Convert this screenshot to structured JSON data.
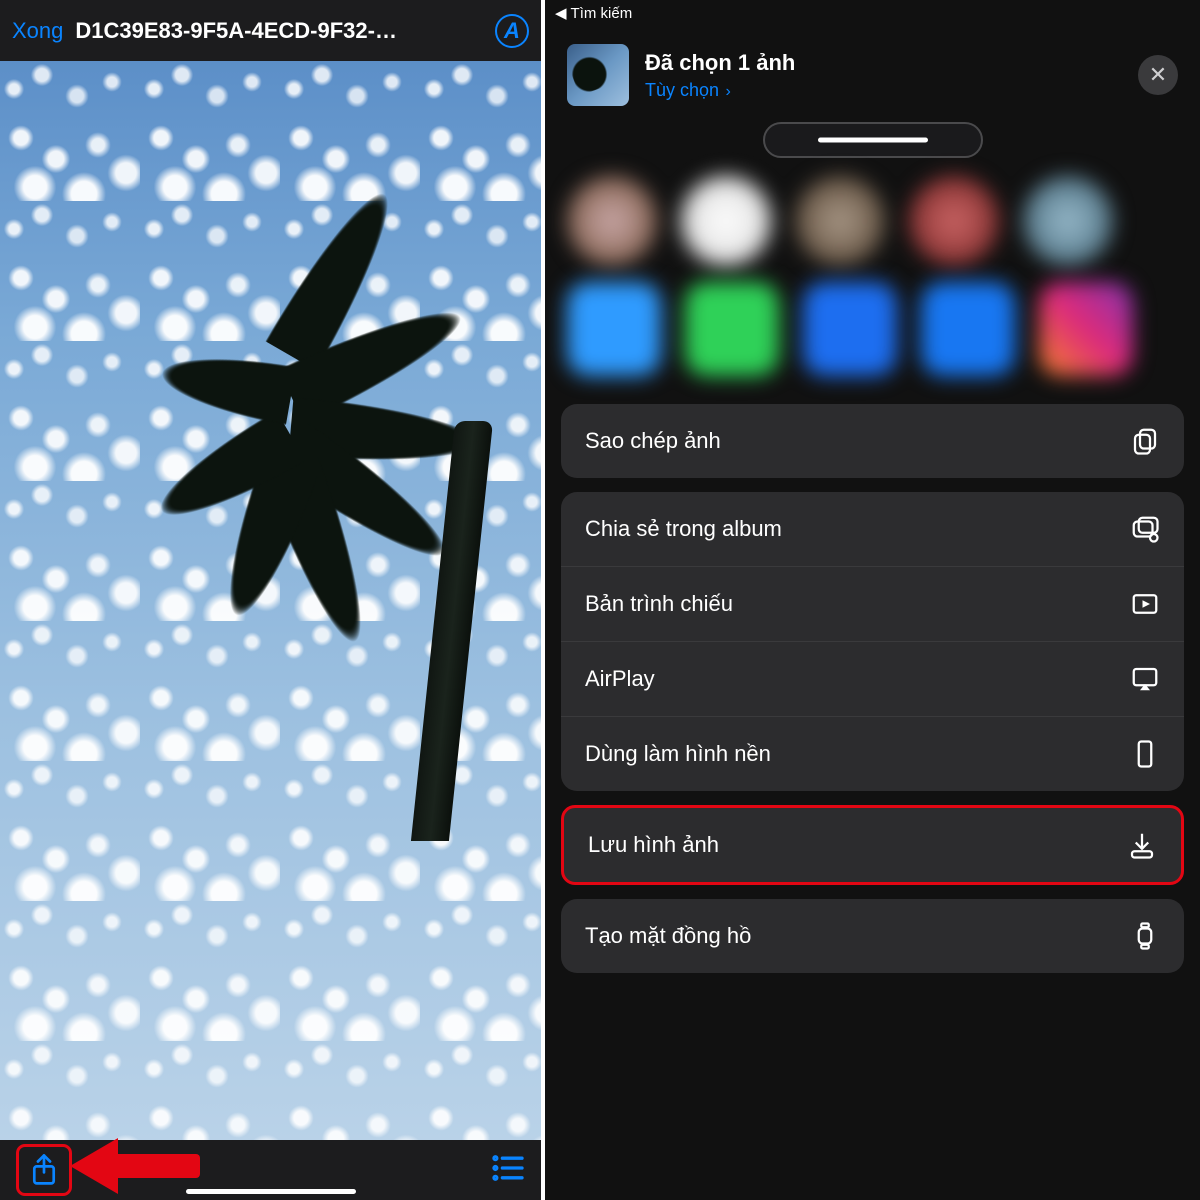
{
  "left": {
    "done_label": "Xong",
    "title": "D1C39E83-9F5A-4ECD-9F32-…",
    "markup_badge": "A"
  },
  "right": {
    "back_label": "Tìm kiếm",
    "selection_title": "Đã chọn 1 ảnh",
    "options_label": "Tùy chọn",
    "actions": {
      "copy": "Sao chép ảnh",
      "share_album": "Chia sẻ trong album",
      "slideshow": "Bản trình chiếu",
      "airplay": "AirPlay",
      "wallpaper": "Dùng làm hình nền",
      "save": "Lưu hình ảnh",
      "watchface": "Tạo mặt đồng hồ"
    }
  },
  "colors": {
    "accent": "#0a84ff",
    "highlight": "#e30613"
  }
}
